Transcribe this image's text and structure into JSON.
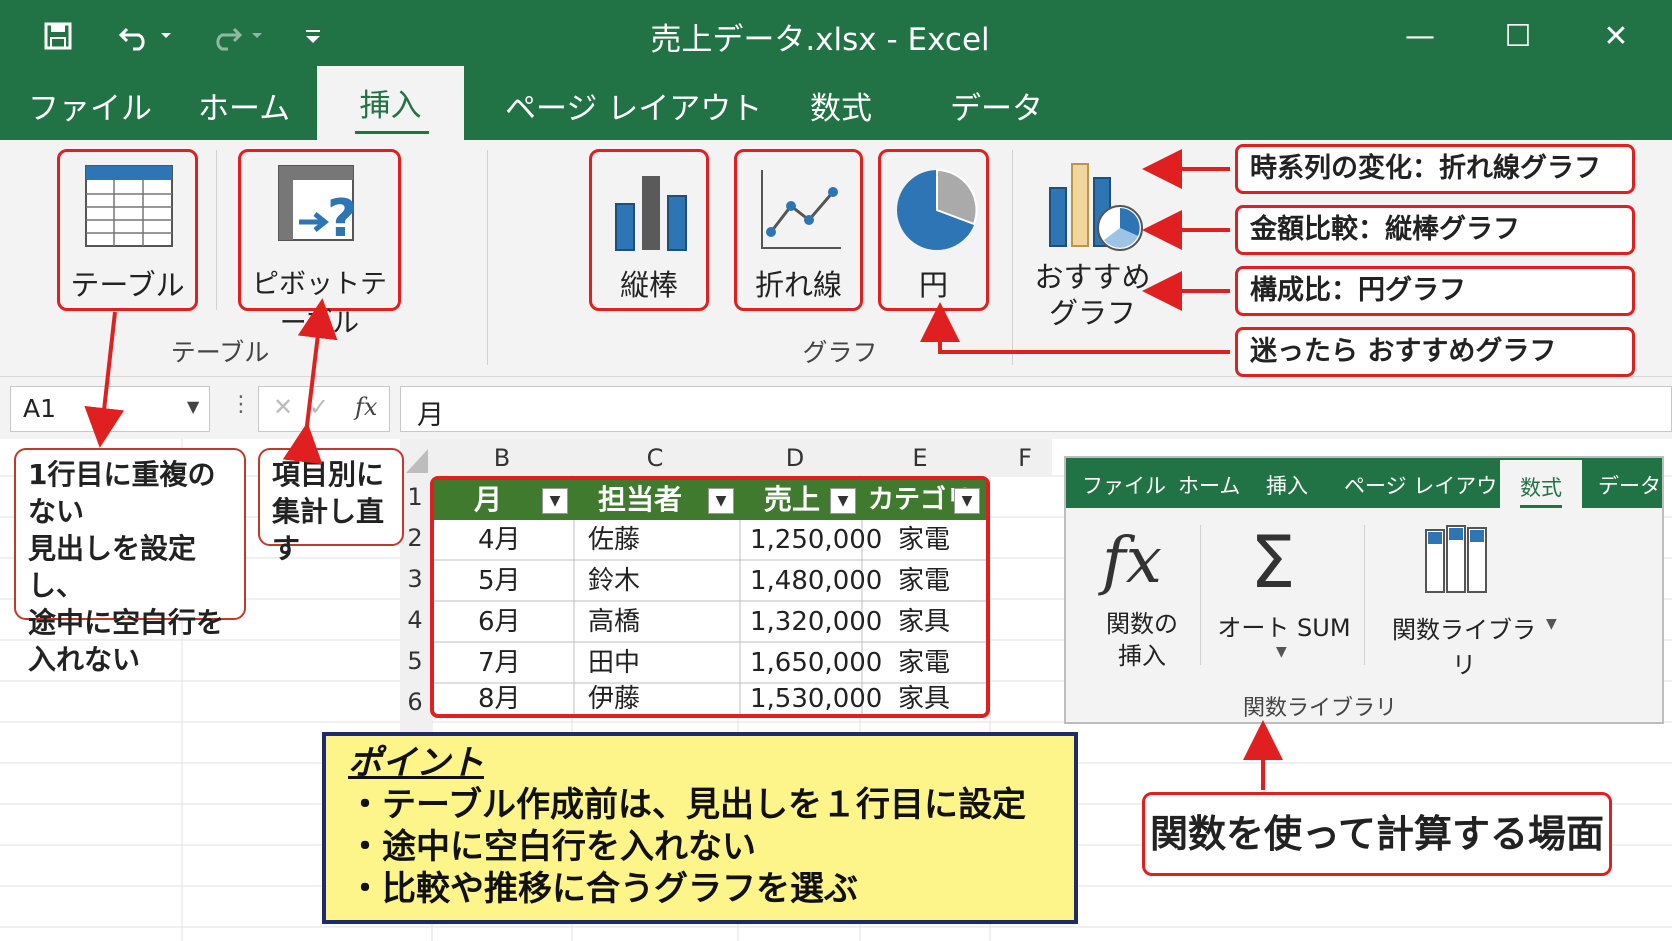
{
  "title": "売上データ.xlsx  -  Excel",
  "quick_access": {
    "save_icon": "save-icon",
    "undo_icon": "undo-icon",
    "redo_icon": "redo-icon",
    "customize_icon": "customize-qat-icon"
  },
  "window_controls": {
    "minimize": "—",
    "maximize": "☐",
    "close": "✕"
  },
  "tabs": [
    "ファイル",
    "ホーム",
    "挿入",
    "ページ レイアウト",
    "数式",
    "データ"
  ],
  "ribbon": {
    "table_button": "テーブル",
    "pivot_button": "ピボットテーブル",
    "table_group": "テーブル",
    "bar_button": "縦棒",
    "line_button": "折れ線",
    "pie_button": "円",
    "recommended_button_line1": "おすすめ",
    "recommended_button_line2": "グラフ",
    "chart_group": "グラフ"
  },
  "callouts": [
    "時系列の変化：折れ線グラフ",
    "金額比較：縦棒グラフ",
    "構成比：円グラフ",
    "迷ったら おすすめグラフ"
  ],
  "formula_bar": {
    "name_box": "A1",
    "fx": "fx",
    "value": "月"
  },
  "notes": {
    "table_note_lines": [
      "1行目に重複のない",
      "見出しを設定し、",
      "途中に空白行を",
      "入れない"
    ],
    "pivot_note_lines": [
      "項目別に",
      "集計し直す"
    ]
  },
  "columns": [
    "B",
    "C",
    "D",
    "E",
    "F"
  ],
  "rows": [
    "1",
    "2",
    "3",
    "4",
    "5",
    "6"
  ],
  "table": {
    "headers": [
      "月",
      "担当者",
      "売上",
      "カテゴリ"
    ],
    "rows": [
      [
        "4月",
        "佐藤",
        "1,250,000",
        "家電"
      ],
      [
        "5月",
        "鈴木",
        "1,480,000",
        "家電"
      ],
      [
        "6月",
        "高橋",
        "1,320,000",
        "家具"
      ],
      [
        "7月",
        "田中",
        "1,650,000",
        "家電"
      ],
      [
        "8月",
        "伊藤",
        "1,530,000",
        "家具"
      ]
    ]
  },
  "point_box": {
    "title": "ポイント",
    "bullets": [
      "・テーブル作成前は、見出しを１行目に設定",
      "・途中に空白行を入れない",
      "・比較や推移に合うグラフを選ぶ"
    ]
  },
  "formula_inset": {
    "tabs": [
      "ファイル",
      "ホーム",
      "挿入",
      "ページ レイアウト",
      "数式",
      "データ"
    ],
    "insert_function_line1": "関数の",
    "insert_function_line2": "挿入",
    "autosum": "オート SUM",
    "library": "関数ライブラリ",
    "group": "関数ライブラリ"
  },
  "formula_note": "関数を使って計算する場面",
  "colors": {
    "excel_green": "#217346",
    "header_green": "#3f7a2e",
    "callout_red": "#e02020",
    "point_yellow": "#fdf58a",
    "point_border": "#1f2a6b"
  }
}
